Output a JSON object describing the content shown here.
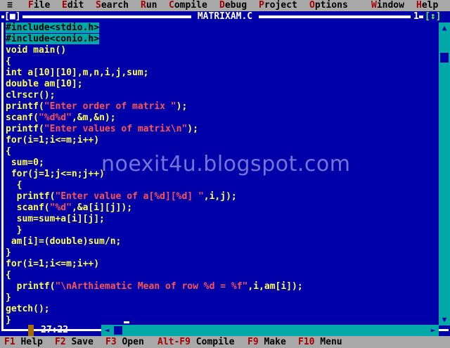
{
  "menu": {
    "system": "≡",
    "items": [
      {
        "hot": "F",
        "rest": "ile"
      },
      {
        "hot": "E",
        "rest": "dit"
      },
      {
        "hot": "S",
        "rest": "earch"
      },
      {
        "hot": "R",
        "rest": "un"
      },
      {
        "hot": "C",
        "rest": "ompile"
      },
      {
        "hot": "D",
        "rest": "ebug"
      },
      {
        "hot": "P",
        "rest": "roject"
      },
      {
        "hot": "O",
        "rest": "ptions"
      },
      {
        "hot": "W",
        "rest": "indow"
      },
      {
        "hot": "H",
        "rest": "elp"
      }
    ]
  },
  "window": {
    "title": "MATRIXAM.C",
    "close_button": "[■]",
    "number": "1",
    "zoom_button": "[↕]"
  },
  "editor": {
    "lines": [
      [
        {
          "t": "#include<stdio.h>",
          "c": "pre"
        }
      ],
      [
        {
          "t": "#include<conio.h>",
          "c": "pre"
        }
      ],
      [
        {
          "t": "void main()"
        }
      ],
      [
        {
          "t": "{"
        }
      ],
      [
        {
          "t": "int a[10][10],m,n,i,j,sum;"
        }
      ],
      [
        {
          "t": "double am[10];"
        }
      ],
      [
        {
          "t": "clrscr();"
        }
      ],
      [
        {
          "t": "printf("
        },
        {
          "t": "\"Enter order of matrix \"",
          "c": "str"
        },
        {
          "t": ");"
        }
      ],
      [
        {
          "t": "scanf("
        },
        {
          "t": "\"%d%d\"",
          "c": "str"
        },
        {
          "t": ",&m,&n);"
        }
      ],
      [
        {
          "t": "printf("
        },
        {
          "t": "\"Enter values of matrix\\n\"",
          "c": "str"
        },
        {
          "t": ");"
        }
      ],
      [
        {
          "t": "for(i=1;i<=m;i++)"
        }
      ],
      [
        {
          "t": "{"
        }
      ],
      [
        {
          "t": " sum=0;"
        }
      ],
      [
        {
          "t": " for(j=1;j<=n;j++)"
        }
      ],
      [
        {
          "t": "  {"
        }
      ],
      [
        {
          "t": "  printf("
        },
        {
          "t": "\"Enter value of a[%d][%d] \"",
          "c": "str"
        },
        {
          "t": ",i,j);"
        }
      ],
      [
        {
          "t": "  scanf("
        },
        {
          "t": "\"%d\"",
          "c": "str"
        },
        {
          "t": ",&a[i][j]);"
        }
      ],
      [
        {
          "t": "  sum=sum+a[i][j];"
        }
      ],
      [
        {
          "t": "  }"
        }
      ],
      [
        {
          "t": " am[i]=(double)sum/n;"
        }
      ],
      [
        {
          "t": "}"
        }
      ],
      [
        {
          "t": "for(i=1;i<=m;i++)"
        }
      ],
      [
        {
          "t": "{"
        }
      ],
      [
        {
          "t": "  printf("
        },
        {
          "t": "\"\\nArthiematic Mean of row %d = %f\"",
          "c": "str"
        },
        {
          "t": ",i,am[i]);"
        }
      ],
      [
        {
          "t": "}"
        }
      ],
      [
        {
          "t": "getch();"
        }
      ],
      [
        {
          "t": "}"
        }
      ]
    ]
  },
  "cursor_position": "27:22",
  "watermark": "noexit4u.blogspot.com",
  "statusbar": {
    "items": [
      {
        "key": "F1",
        "label": " Help"
      },
      {
        "key": "F2",
        "label": " Save"
      },
      {
        "key": "F3",
        "label": " Open"
      },
      {
        "key": "Alt-F9",
        "label": " Compile"
      },
      {
        "key": "F9",
        "label": " Make"
      },
      {
        "key": "F10",
        "label": " Menu"
      }
    ]
  },
  "colors": {
    "background": "#0000a8",
    "menu_bg": "#a8a8a8",
    "hotkey": "#a80000",
    "code": "#ffff54",
    "string": "#fc5454",
    "preprocessor_bg": "#00a8a8",
    "scrollbar": "#00a8a8"
  }
}
